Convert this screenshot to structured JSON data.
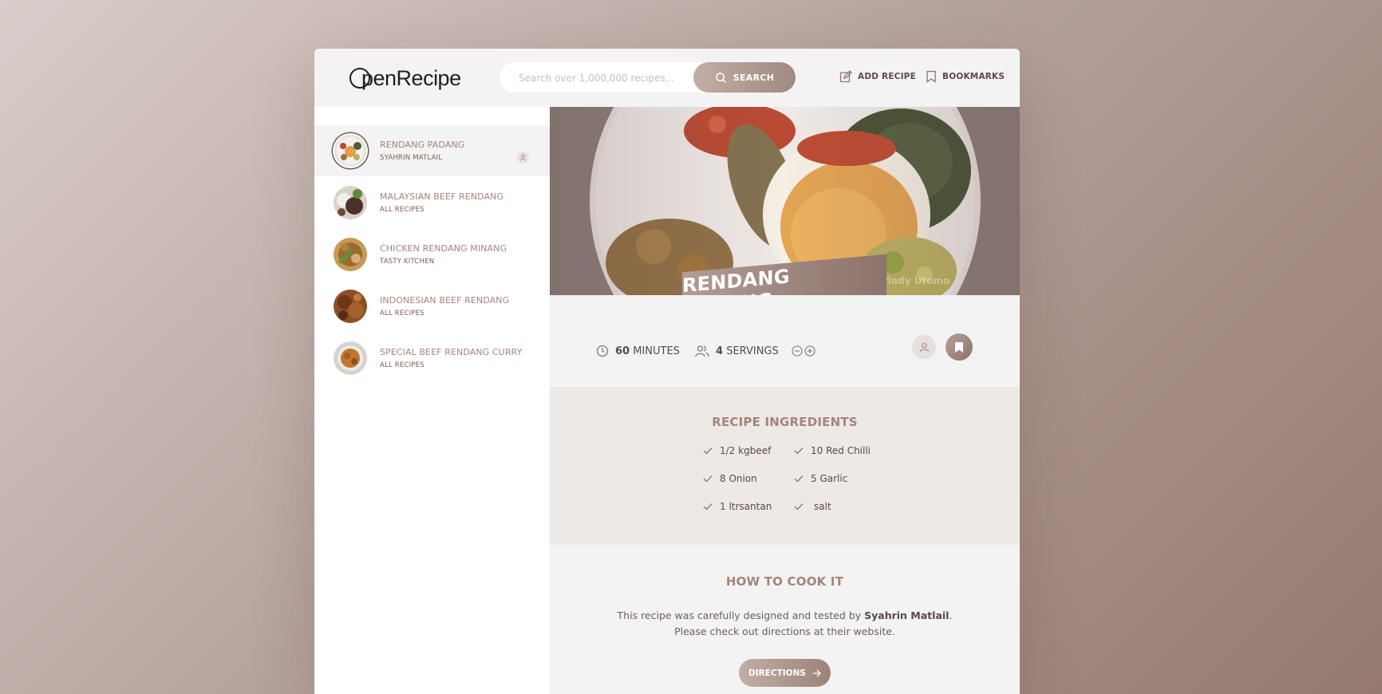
{
  "header": {
    "logo_text": "penRecipe",
    "search_placeholder": "Search over 1,000,000 recipes...",
    "search_label": "SEARCH",
    "add_recipe_label": "ADD RECIPE",
    "bookmarks_label": "BOOKMARKS"
  },
  "results": [
    {
      "title": "RENDANG PADANG",
      "publisher": "SYAHRIN MATLAIL",
      "active": true
    },
    {
      "title": "MALAYSIAN BEEF RENDANG",
      "publisher": "ALL RECIPES"
    },
    {
      "title": "CHICKEN RENDANG MINANG",
      "publisher": "TASTY KITCHEN"
    },
    {
      "title": "INDONESIAN BEEF RENDANG",
      "publisher": "ALL RECIPES"
    },
    {
      "title": "SPECIAL BEEF RENDANG CURRY",
      "publisher": "ALL RECIPES"
    }
  ],
  "recipe": {
    "title": "RENDANG PADANG",
    "photo_credit": "riady Utomo",
    "cooking_time": "60",
    "cooking_time_unit": "MINUTES",
    "servings": "4",
    "servings_unit": "SERVINGS",
    "ingredients_heading": "RECIPE INGREDIENTS",
    "ingredients": [
      "1/2 kgbeef",
      "10 Red Chilli",
      "8 Onion",
      "5 Garlic",
      "1 ltrsantan",
      "salt"
    ],
    "howto_heading": "HOW TO COOK IT",
    "howto_text_before": "This recipe was carefully designed and tested by ",
    "howto_publisher": "Syahrin Matlail",
    "howto_text_after": ". Please check out directions at their website.",
    "directions_label": "DIRECTIONS"
  },
  "colors": {
    "accent": "#a4857c",
    "accent_dark": "#8c736b",
    "text": "#5b4a45"
  }
}
